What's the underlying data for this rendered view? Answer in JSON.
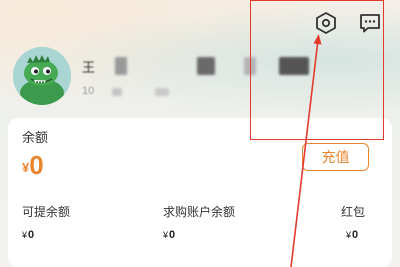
{
  "header": {
    "icons": [
      "settings-hexagon-icon",
      "message-icon"
    ]
  },
  "profile": {
    "name_visible_char": "王",
    "id_prefix": "10"
  },
  "balance": {
    "label": "余额",
    "currency": "¥",
    "value": "0",
    "recharge_label": "充值"
  },
  "sub_balances": [
    {
      "label": "可提余额",
      "currency": "¥",
      "value": "0"
    },
    {
      "label": "求购账户余额",
      "currency": "¥",
      "value": "0"
    },
    {
      "label": "红包",
      "currency": "¥",
      "value": "0"
    }
  ],
  "colors": {
    "accent": "#e9852e",
    "annotation": "#e23b2e"
  }
}
